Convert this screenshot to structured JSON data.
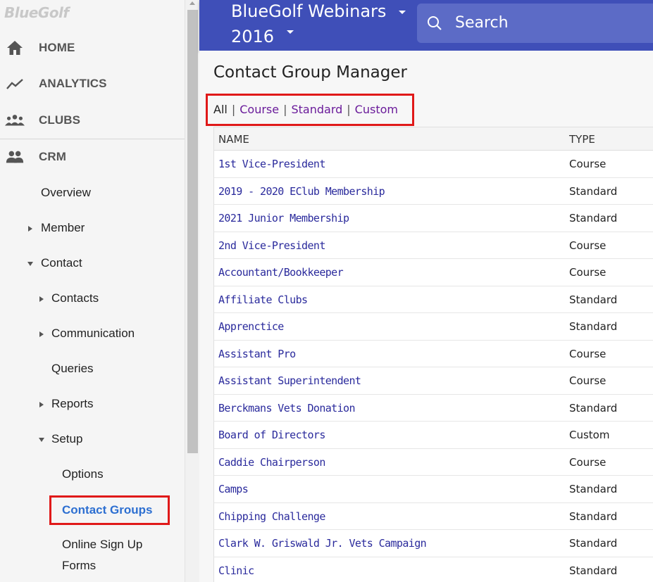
{
  "sidebar": {
    "logo": "BlueGolf",
    "nav": [
      {
        "label": "HOME",
        "icon": "home-icon"
      },
      {
        "label": "ANALYTICS",
        "icon": "trending-icon"
      },
      {
        "label": "CLUBS",
        "icon": "groups-icon"
      },
      {
        "label": "CRM",
        "icon": "people-icon"
      }
    ],
    "crm": {
      "overview": "Overview",
      "member": "Member",
      "contact": "Contact",
      "contacts": "Contacts",
      "communication": "Communication",
      "queries": "Queries",
      "reports": "Reports",
      "setup": "Setup",
      "options": "Options",
      "contact_groups": "Contact Groups",
      "online_signup_line1": "Online Sign Up",
      "online_signup_line2": "Forms"
    }
  },
  "header": {
    "org_title": "BlueGolf Webinars",
    "year": "2016",
    "search_placeholder": "Search"
  },
  "main": {
    "title": "Contact Group Manager",
    "filters": {
      "all": "All",
      "course": "Course",
      "standard": "Standard",
      "custom": "Custom",
      "sep": "|"
    },
    "table": {
      "headers": {
        "name": "NAME",
        "type": "TYPE"
      },
      "rows": [
        {
          "name": "1st Vice-President",
          "type": "Course"
        },
        {
          "name": "2019 - 2020 EClub Membership",
          "type": "Standard"
        },
        {
          "name": "2021 Junior Membership",
          "type": "Standard"
        },
        {
          "name": "2nd Vice-President",
          "type": "Course"
        },
        {
          "name": "Accountant/Bookkeeper",
          "type": "Course"
        },
        {
          "name": "Affiliate Clubs",
          "type": "Standard"
        },
        {
          "name": "Apprenctice",
          "type": "Standard"
        },
        {
          "name": "Assistant Pro",
          "type": "Course"
        },
        {
          "name": "Assistant Superintendent",
          "type": "Course"
        },
        {
          "name": "Berckmans Vets Donation",
          "type": "Standard"
        },
        {
          "name": "Board of Directors",
          "type": "Custom"
        },
        {
          "name": "Caddie Chairperson",
          "type": "Course"
        },
        {
          "name": "Camps",
          "type": "Standard"
        },
        {
          "name": "Chipping Challenge",
          "type": "Standard"
        },
        {
          "name": "Clark W. Griswald Jr. Vets Campaign",
          "type": "Standard"
        },
        {
          "name": "Clinic",
          "type": "Standard"
        }
      ]
    }
  },
  "colors": {
    "header_bg": "#3f4fb8",
    "accent_link": "#2d6fd1",
    "highlight_box": "#e01919",
    "filter_link": "#6a1b9a"
  }
}
